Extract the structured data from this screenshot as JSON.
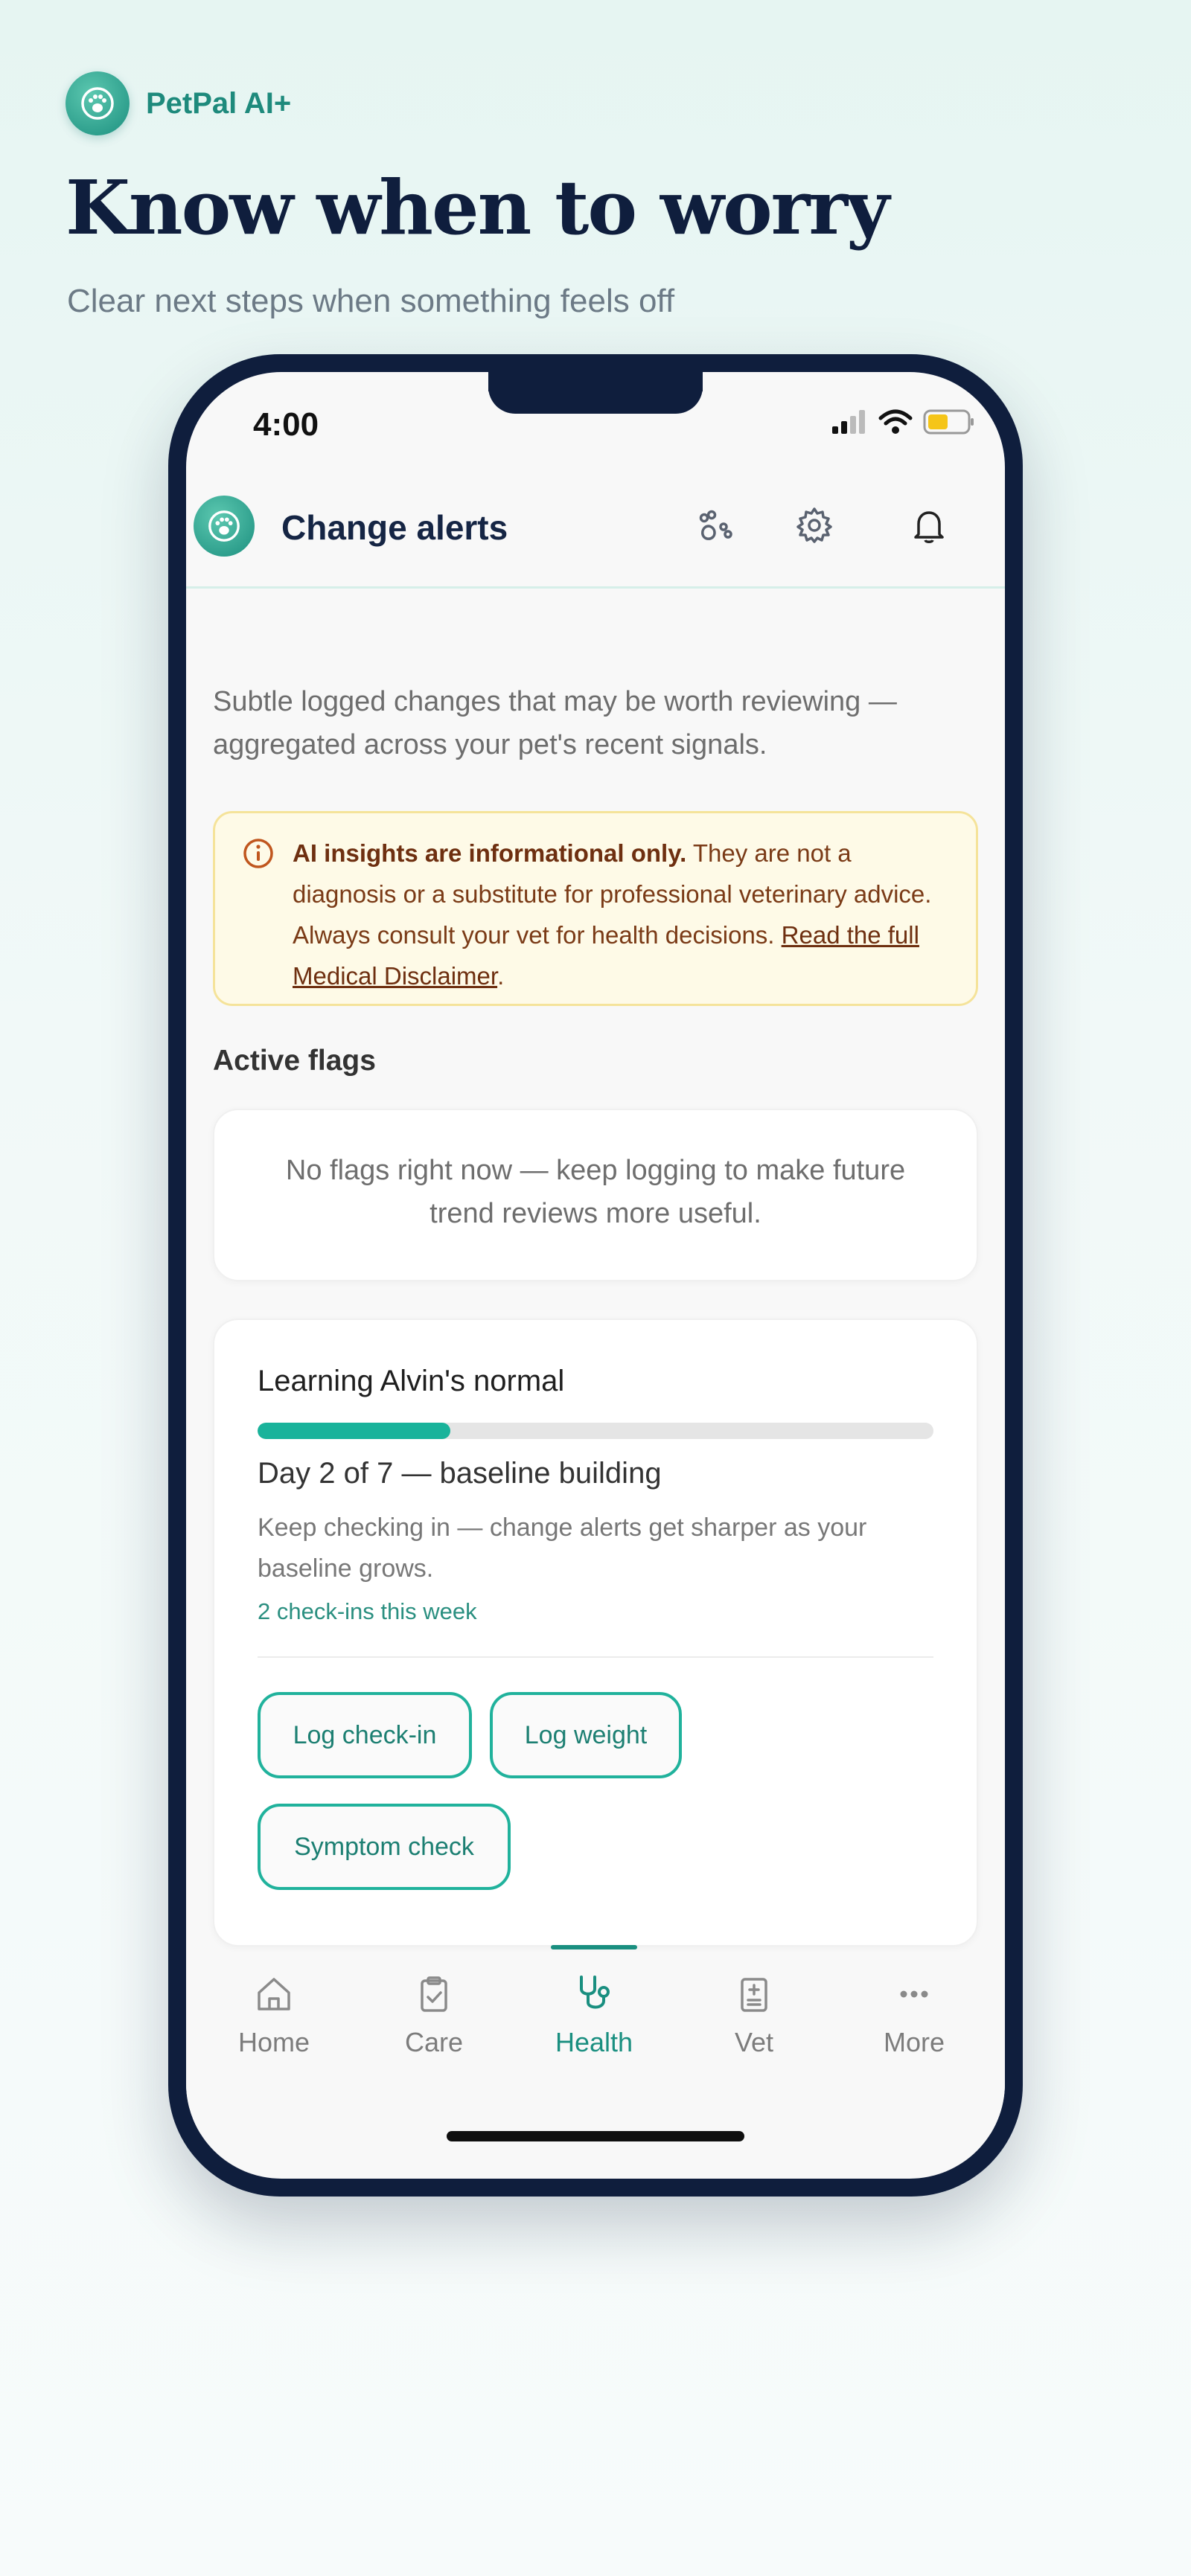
{
  "brand": {
    "name": "PetPal AI+"
  },
  "hero": {
    "headline": "Know when to worry",
    "subheadline": "Clear next steps when something feels off"
  },
  "status_bar": {
    "time": "4:00"
  },
  "app_bar": {
    "title": "Change alerts"
  },
  "intro_text": "Subtle logged changes that may be worth reviewing — aggregated across your pet's recent signals.",
  "disclaimer": {
    "bold": "AI insights are informational only.",
    "text": " They are not a diagnosis or a substitute for professional veterinary advice. Always consult your vet for health decisions.",
    "link": "Read the full Medical Disclaimer",
    "end": "."
  },
  "active_flags": {
    "title": "Active flags",
    "empty_text": "No flags right now — keep logging to make future trend reviews more useful."
  },
  "learning": {
    "title": "Learning Alvin's normal",
    "progress_fraction": 0.2857,
    "day_text": "Day 2 of 7 — baseline building",
    "description": "Keep checking in — change alerts get sharper as your baseline grows.",
    "meta": "2 check-ins this week",
    "buttons": [
      "Log check-in",
      "Log weight",
      "Symptom check"
    ]
  },
  "tabs": [
    {
      "label": "Home",
      "icon": "home-icon"
    },
    {
      "label": "Care",
      "icon": "clipboard-check-icon"
    },
    {
      "label": "Health",
      "icon": "stethoscope-icon",
      "active": true
    },
    {
      "label": "Vet",
      "icon": "medical-clipboard-icon"
    },
    {
      "label": "More",
      "icon": "more-dots-icon"
    }
  ],
  "colors": {
    "accent": "#1a8f80",
    "progress": "#19b39b",
    "navy": "#0f1e3d",
    "warning_bg": "#fefae7",
    "warning_border": "#f5e39a",
    "warning_text": "#7a3a16"
  }
}
